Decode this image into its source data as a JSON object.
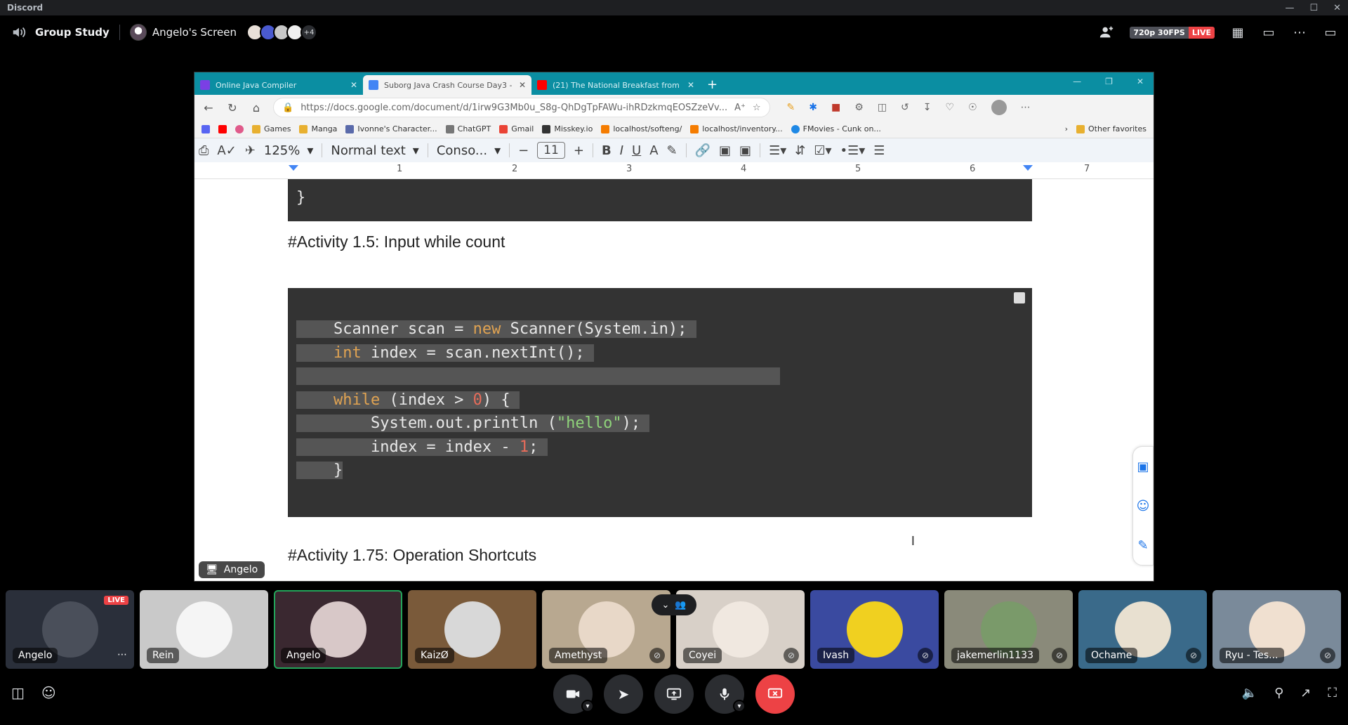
{
  "app": {
    "title": "Discord"
  },
  "header": {
    "channel": "Group Study",
    "stream_name": "Angelo's Screen",
    "viewer_more": "+4",
    "quality": "720p 30FPS",
    "live": "LIVE"
  },
  "browser": {
    "tabs": [
      {
        "label": "Online Java Compiler",
        "color": "#7b3fe4"
      },
      {
        "label": "Suborg Java Crash Course Day3 -",
        "color": "#4285f4"
      },
      {
        "label": "(21) The National Breakfast from",
        "color": "#ff0000"
      }
    ],
    "url": "https://docs.google.com/document/d/1irw9G3Mb0u_S8g-QhDgTpFAWu-ihRDzkmqEOSZzeVv...",
    "bookmarks": [
      "Games",
      "Manga",
      "Ivonne's Character...",
      "ChatGPT",
      "Gmail",
      "Misskey.io",
      "localhost/softeng/",
      "localhost/inventory...",
      "FMovies - Cunk on..."
    ],
    "other_favorites": "Other favorites"
  },
  "docs": {
    "zoom": "125%",
    "style": "Normal text",
    "font": "Conso...",
    "font_size": "11",
    "ruler": [
      "1",
      "2",
      "3",
      "4",
      "5",
      "6",
      "7"
    ],
    "code_top_brace": "}",
    "heading1": "#Activity 1.5: Input while count",
    "heading2": "#Activity 1.75: Operation Shortcuts",
    "code": {
      "l1a": "Scanner scan = ",
      "l1kw": "new",
      "l1b": " Scanner(System.in);",
      "l2kw": "int",
      "l2b": " index = scan.nextInt();",
      "l3kw": "while",
      "l3a": " (index > ",
      "l3num": "0",
      "l3b": ") {",
      "l4a": "    System.out.println (",
      "l4str": "\"hello\"",
      "l4b": ");",
      "l5a": "    index = index - ",
      "l5num": "1",
      "l5b": ";",
      "l6": "}"
    },
    "presenter": "Angelo"
  },
  "participants": [
    {
      "name": "Angelo",
      "bg": "#2a2f3a",
      "av": "#4a4f5a",
      "live": "LIVE"
    },
    {
      "name": "Rein",
      "bg": "#c9c9c9",
      "av": "#f5f5f5"
    },
    {
      "name": "Angelo",
      "bg": "#3a2830",
      "av": "#d8c8c8"
    },
    {
      "name": "KaizØ",
      "bg": "#7a5a3a",
      "av": "#d8d8d8"
    },
    {
      "name": "Amethyst",
      "bg": "#b8a890",
      "av": "#e8d8c8"
    },
    {
      "name": "Coyei",
      "bg": "#d8d0c8",
      "av": "#f0e8e0"
    },
    {
      "name": "Ivash",
      "bg": "#3a4aa0",
      "av": "#f0d020"
    },
    {
      "name": "jakemerlin1133",
      "bg": "#8a8a7a",
      "av": "#7a9a6a"
    },
    {
      "name": "Ochame",
      "bg": "#3a6a8a",
      "av": "#e8e0d0"
    },
    {
      "name": "Ryu - Tes...",
      "bg": "#7a8a9a",
      "av": "#f0e0d0"
    }
  ]
}
